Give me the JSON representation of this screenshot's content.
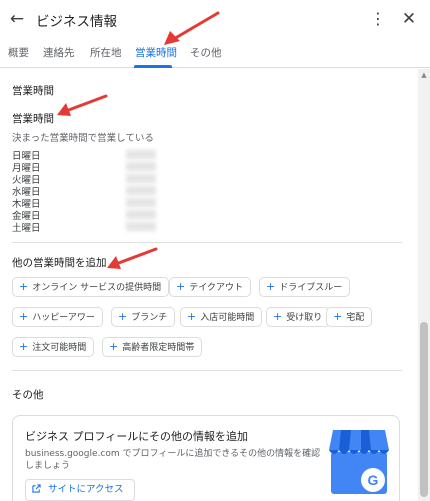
{
  "header": {
    "title": "ビジネス情報",
    "back_icon": "arrow-left-icon",
    "more_icon": "more-vert-icon",
    "close_icon": "close-icon"
  },
  "tabs": [
    {
      "label": "概要",
      "active": false
    },
    {
      "label": "連絡先",
      "active": false
    },
    {
      "label": "所在地",
      "active": false
    },
    {
      "label": "営業時間",
      "active": true
    },
    {
      "label": "その他",
      "active": false
    }
  ],
  "hours": {
    "section_title": "営業時間",
    "subtitle": "営業時間",
    "description": "決まった営業時間で営業している",
    "days": [
      "日曜日",
      "月曜日",
      "火曜日",
      "水曜日",
      "木曜日",
      "金曜日",
      "土曜日"
    ]
  },
  "more_hours": {
    "title": "他の営業時間を追加",
    "chips": [
      "オンライン サービスの提供時間",
      "テイクアウト",
      "ドライブスルー",
      "ハッピーアワー",
      "ブランチ",
      "入店可能時間",
      "受け取り",
      "宅配",
      "注文可能時間",
      "高齢者限定時間帯"
    ]
  },
  "other": {
    "title": "その他",
    "promo_title": "ビジネス プロフィールにその他の情報を追加",
    "promo_desc": "business.google.com でプロフィールに追加できるその他の情報を確認しましょう",
    "visit_label": "サイトにアクセス",
    "visit_icon": "open-in-new-icon",
    "logo_icon": "google-my-business-icon"
  },
  "colors": {
    "accent": "#1a73e8",
    "annotation_arrow": "#e53935"
  }
}
